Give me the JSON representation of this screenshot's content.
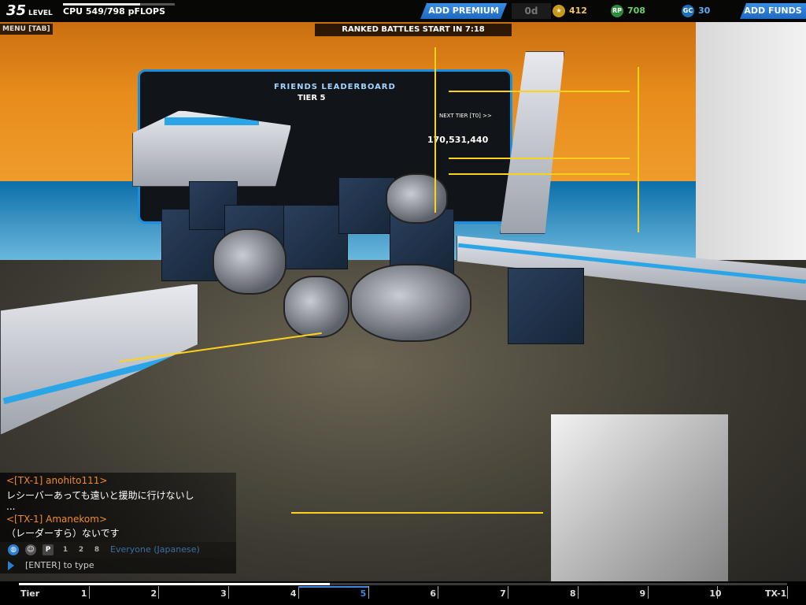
{
  "hud": {
    "level_number": "35",
    "level_word": "LEVEL",
    "cpu_text": "CPU 549/798 pFLOPS",
    "cpu_fraction": 0.688,
    "premium_button": "ADD PREMIUM",
    "premium_days": "0d",
    "robits": "412",
    "rp": "708",
    "gc": "30",
    "rp_icon_text": "RP",
    "gc_icon_text": "GC",
    "funds_button": "ADD FUNDS",
    "menu_label": "MENU [TAB]",
    "ranked_text": "RANKED BATTLES START IN 7:18"
  },
  "scene": {
    "board_header": "FRIENDS LEADERBOARD",
    "board_tier": "TIER 5",
    "board_next": "NEXT TIER [T0] >>",
    "board_score": "170,531,440"
  },
  "chat": {
    "messages": [
      {
        "name": "<[TX-1] anohito111>",
        "text": "レシーバーあっても遠いと援助に行けないし"
      },
      {
        "name": "",
        "text": "..."
      },
      {
        "name": "<[TX-1] Amanekom>",
        "text": "（レーダーすら）ないです"
      }
    ],
    "channel_label": "Everyone (Japanese)",
    "party_counts": [
      "1",
      "2",
      "8"
    ],
    "input_hint": "[ENTER] to type"
  },
  "tier_bar": {
    "labels": [
      "Tier",
      "1",
      "2",
      "3",
      "4",
      "5",
      "6",
      "7",
      "8",
      "9",
      "10",
      "TX-1"
    ],
    "current_index": 5,
    "progress_fraction": 0.405
  },
  "colors": {
    "accent_blue": "#2a7fd0",
    "chat_name": "#f08a2a",
    "guide_yellow": "#ffd21a"
  }
}
